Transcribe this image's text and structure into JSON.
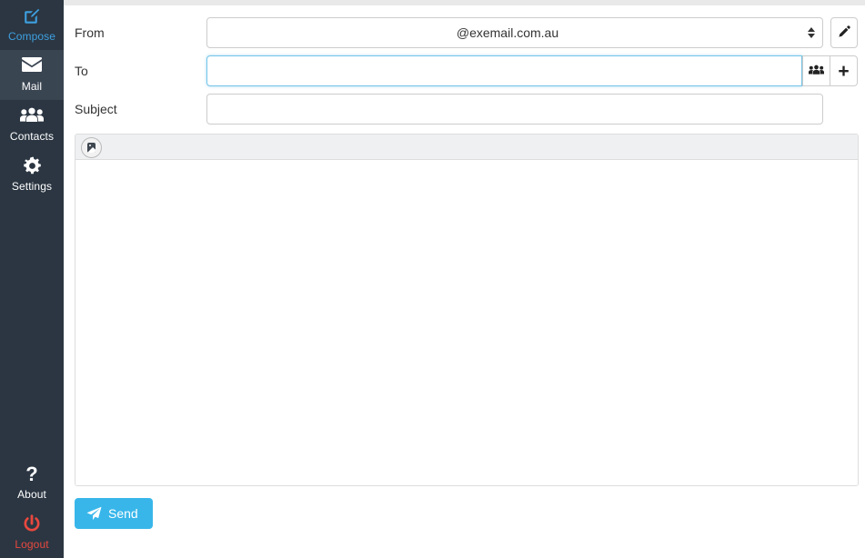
{
  "app": {
    "accent_blue": "#38b6ea",
    "sidebar_bg": "#2b3642",
    "sidebar_active_bg": "#3a4552",
    "logout_color": "#e8483f",
    "compose_color": "#3ea0e0"
  },
  "sidebar": {
    "items": [
      {
        "id": "compose",
        "label": "Compose",
        "icon": "compose-pencil-square-icon"
      },
      {
        "id": "mail",
        "label": "Mail",
        "icon": "envelope-icon"
      },
      {
        "id": "contacts",
        "label": "Contacts",
        "icon": "users-icon"
      },
      {
        "id": "settings",
        "label": "Settings",
        "icon": "gear-icon"
      }
    ],
    "bottom_items": [
      {
        "id": "about",
        "label": "About",
        "icon": "question-mark-icon"
      },
      {
        "id": "logout",
        "label": "Logout",
        "icon": "power-icon"
      }
    ]
  },
  "compose": {
    "from": {
      "label": "From",
      "selected": "@exemail.com.au",
      "options": [
        "@exemail.com.au"
      ],
      "edit_button_icon": "pencil-icon"
    },
    "to": {
      "label": "To",
      "value": "",
      "placeholder": "",
      "focused": true,
      "contacts_button_icon": "users-icon",
      "add_button_label": "+"
    },
    "subject": {
      "label": "Subject",
      "value": "",
      "placeholder": ""
    },
    "editor": {
      "toolbar": [
        {
          "id": "insert-image",
          "icon": "image-icon",
          "title": "Insert image"
        }
      ],
      "body": ""
    },
    "send": {
      "label": "Send",
      "icon": "paper-plane-icon"
    }
  }
}
